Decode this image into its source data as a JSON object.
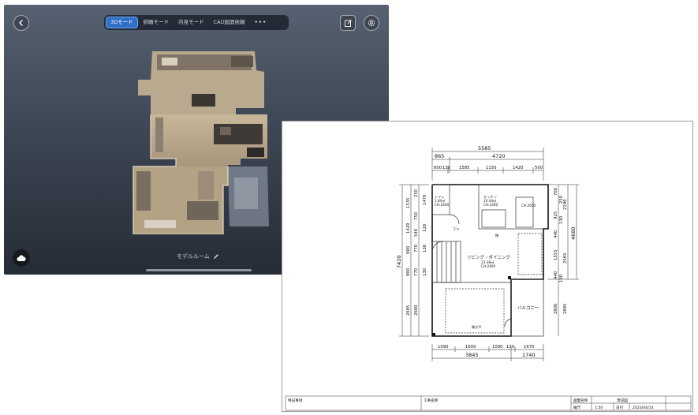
{
  "viewer": {
    "tabs": [
      {
        "label": "3Dモード",
        "active": true
      },
      {
        "label": "俯瞰モード",
        "active": false
      },
      {
        "label": "内見モード",
        "active": false
      },
      {
        "label": "CAD図面依頼",
        "active": false
      },
      {
        "label": "•••",
        "active": false
      }
    ],
    "model_name": "モデルルーム",
    "icons": {
      "back": "chevron-left-icon",
      "edit": "edit-icon",
      "settings": "gear-icon",
      "cloud": "cloud-icon",
      "rename": "pencil-icon"
    },
    "accent_color": "#2f6fc5"
  },
  "floor_plan": {
    "dims_top": {
      "overall": "5585",
      "inner": "4720",
      "left_offset": "865",
      "segments": [
        "800",
        "130",
        "1585",
        "1150",
        "1420",
        "500"
      ]
    },
    "dims_bottom": {
      "segments": [
        "1090",
        "1600",
        "1090",
        "130",
        "1675"
      ],
      "totals": [
        "3845",
        "1740"
      ]
    },
    "dims_left": {
      "overall": "7420",
      "segments_a": [
        "1535",
        "250",
        "1470",
        "1420",
        "750",
        "540",
        "120",
        "900",
        "770",
        "130",
        "900",
        "770",
        "130",
        "2685",
        "2600"
      ]
    },
    "dims_right": {
      "overall": "4680",
      "segments": [
        "700",
        "250",
        "2190",
        "925",
        "130",
        "440",
        "1555",
        "2565",
        "440",
        "130",
        "2600",
        "2685"
      ]
    },
    "rooms": {
      "toilet": {
        "name": "トイレ",
        "area": "1.84㎡",
        "ch": "CH:2400"
      },
      "kitchen": {
        "name": "キッチン",
        "area": "10.44㎡",
        "ch": "CH:2300"
      },
      "ch_2050": "CH:2050",
      "living": {
        "name": "リビング・ダイニング",
        "area": "23.38㎡",
        "ch": "CH:2400"
      },
      "balcony": "バルコニー",
      "stairs_down": "下り",
      "shelf": "棚",
      "hiraki": "開き戸"
    },
    "title_block": {
      "notes_label": "特記事項",
      "project_label": "工事名称",
      "drawing_label": "図面名称",
      "drawing_name": "現況図",
      "scale_label": "縮尺",
      "scale": "1:50",
      "date_label": "日付",
      "date": "2023/04/14"
    }
  }
}
